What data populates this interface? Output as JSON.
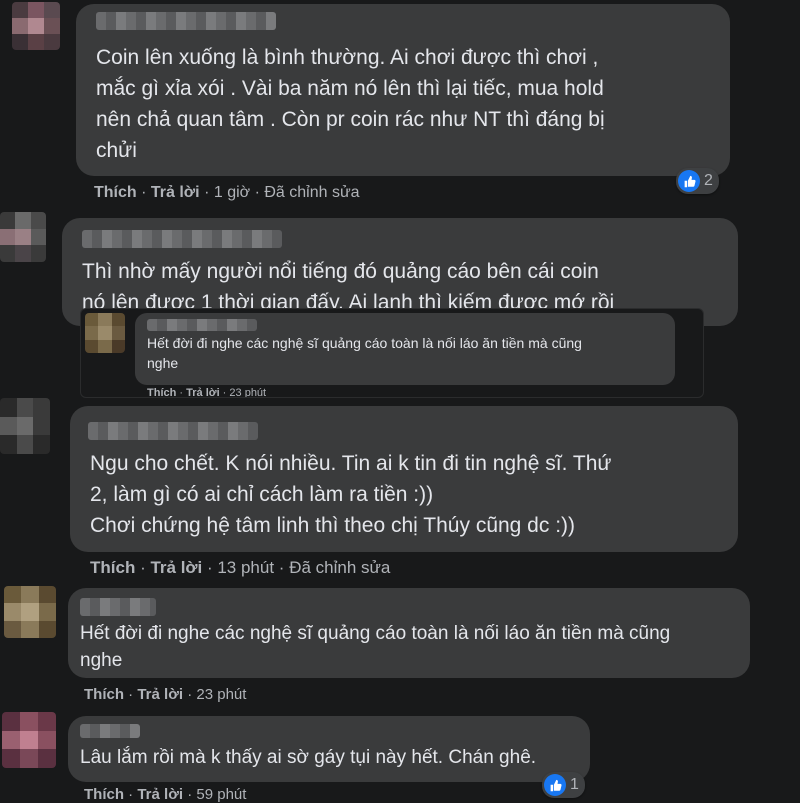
{
  "comments": [
    {
      "text": "Coin lên xuống là bình thường. Ai chơi được thì chơi ,\nmắc gì xỉa xói . Vài ba năm nó lên thì lại tiếc, mua hold\nnên chả quan tâm . Còn pr coin rác như NT thì đáng bị\nchửi",
      "like": "Thích",
      "reply": "Trả lời",
      "time": "1 giờ",
      "edited": "Đã chỉnh sửa",
      "reaction_count": "2"
    },
    {
      "text": "Thì nhờ mấy người nổi tiếng đó quảng cáo bên cái coin\nnó lên được 1 thời gian đấy. Ai lanh thì kiếm được mớ rồi",
      "embedded": {
        "text": "Hết đời đi nghe các nghệ sĩ quảng cáo toàn là nối láo ăn tiền mà cũng\nnghe",
        "like": "Thích",
        "reply": "Trả lời",
        "time": "23 phút"
      }
    },
    {
      "text": "Ngu cho chết. K nói nhiều. Tin ai k tin đi tin nghệ sĩ. Thứ\n2, làm gì có ai chỉ cách làm ra tiền :))\nChơi chứng hệ tâm linh thì theo chị Thúy cũng dc :))",
      "like": "Thích",
      "reply": "Trả lời",
      "time": "13 phút",
      "edited": "Đã chỉnh sửa"
    },
    {
      "text": "Hết đời đi nghe các nghệ sĩ quảng cáo toàn là nối láo ăn tiền mà cũng\nnghe",
      "like": "Thích",
      "reply": "Trả lời",
      "time": "23 phút"
    },
    {
      "text": "Lâu lắm rồi mà k thấy ai sờ gáy tụi này hết. Chán ghê.",
      "like": "Thích",
      "reply": "Trả lời",
      "time": "59 phút",
      "reaction_count": "1"
    }
  ],
  "separator": " · ",
  "colors": {
    "background": "#18191a",
    "bubble": "#3a3b3c",
    "text": "#e4e6eb",
    "secondary_text": "#b0b3b8",
    "like_blue": "#1877f2"
  },
  "icons": {
    "reaction": "thumbs-up-icon"
  }
}
